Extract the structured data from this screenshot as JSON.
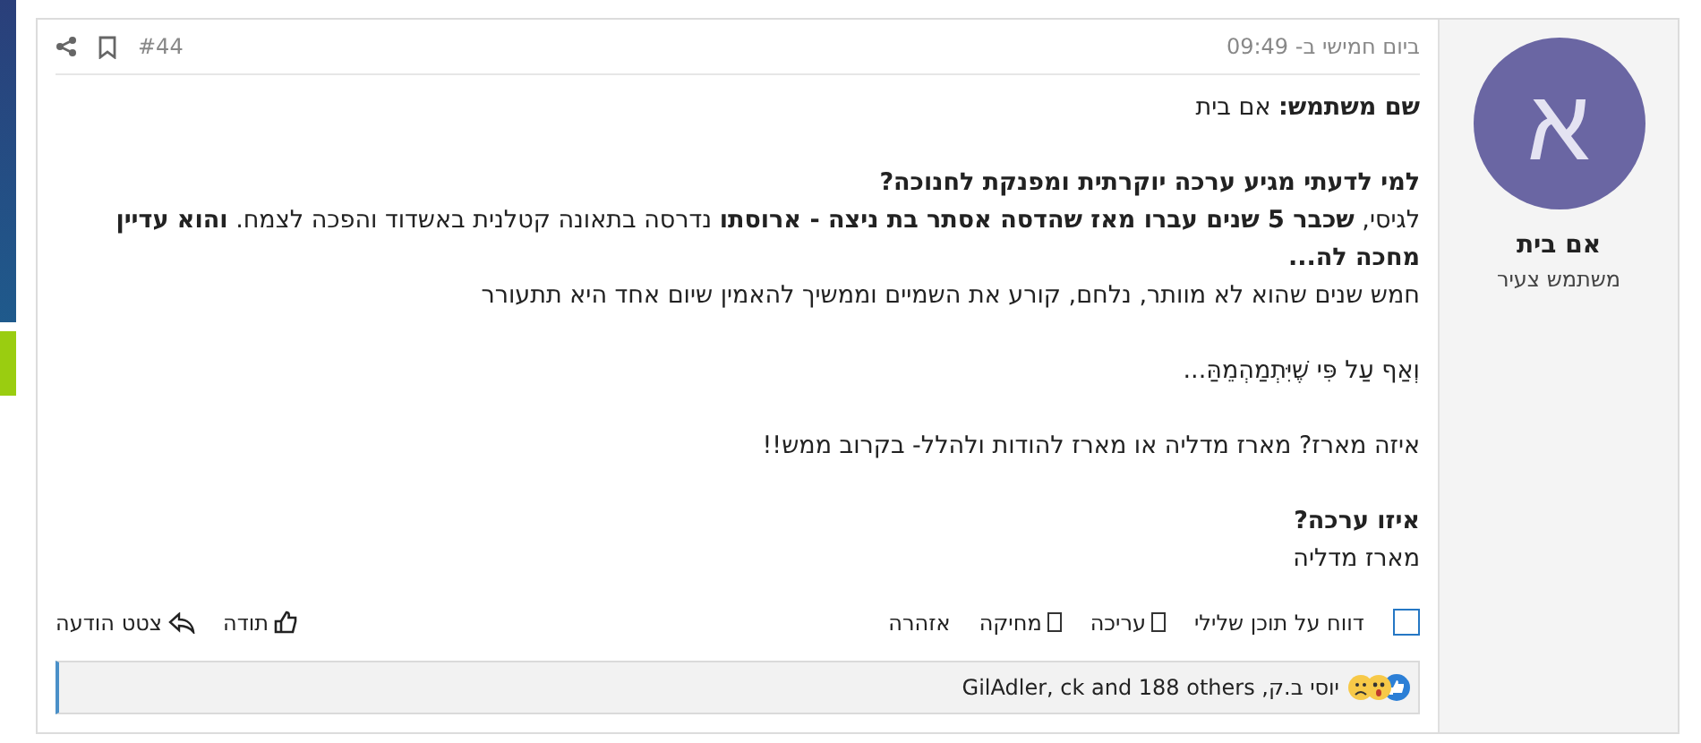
{
  "post": {
    "number": "#44",
    "time": "ביום חמישי ב- 09:49",
    "author": {
      "initial": "א",
      "name": "אם בית",
      "title": "משתמש צעיר"
    },
    "body": [
      [
        {
          "kind": "text",
          "text": "**שם משתמש:** אם בית"
        }
      ],
      [
        {
          "kind": "heading",
          "text": "למי לדעתי מגיע ערכה יוקרתית ומפנקת לחנוכה?"
        },
        {
          "kind": "text",
          "text": "לגיסי, **שכבר 5 שנים עברו מאז שהדסה אסתר בת ניצה - ארוסתו** נדרסה בתאונה קטלנית באשדוד והפכה לצמח. **והוא עדיין מחכה לה...**"
        },
        {
          "kind": "text",
          "text": "חמש שנים שהוא לא מוותר, נלחם, קורע את השמיים וממשיך להאמין שיום אחד היא תתעורר"
        }
      ],
      [
        {
          "kind": "text",
          "text": "וְאַף עַל פִּי שֶׁיִּתְמַהְמֵהַּ..."
        }
      ],
      [
        {
          "kind": "text",
          "text": "איזה מארז? מארז מדליה או מארז להודות ולהלל- בקרוב ממש!!"
        }
      ],
      [
        {
          "kind": "heading",
          "text": "איזו ערכה?"
        },
        {
          "kind": "text",
          "text": "מארז מדליה"
        }
      ]
    ],
    "select": {
      "checked": false
    },
    "actions": [
      {
        "label": "דווח על תוכן שלילי",
        "kind": "plain"
      },
      {
        "label": "עריכה",
        "kind": "box"
      },
      {
        "label": "מחיקה",
        "kind": "box"
      },
      {
        "label": "אזהרה",
        "kind": "plain"
      }
    ],
    "reply_actions": [
      {
        "label": "תודה",
        "kind": "like"
      },
      {
        "label": "צטט הודעה",
        "kind": "quote"
      }
    ],
    "reactions": {
      "text": "יוסי ב.ק, GilAdler, ck and 188 others"
    }
  }
}
